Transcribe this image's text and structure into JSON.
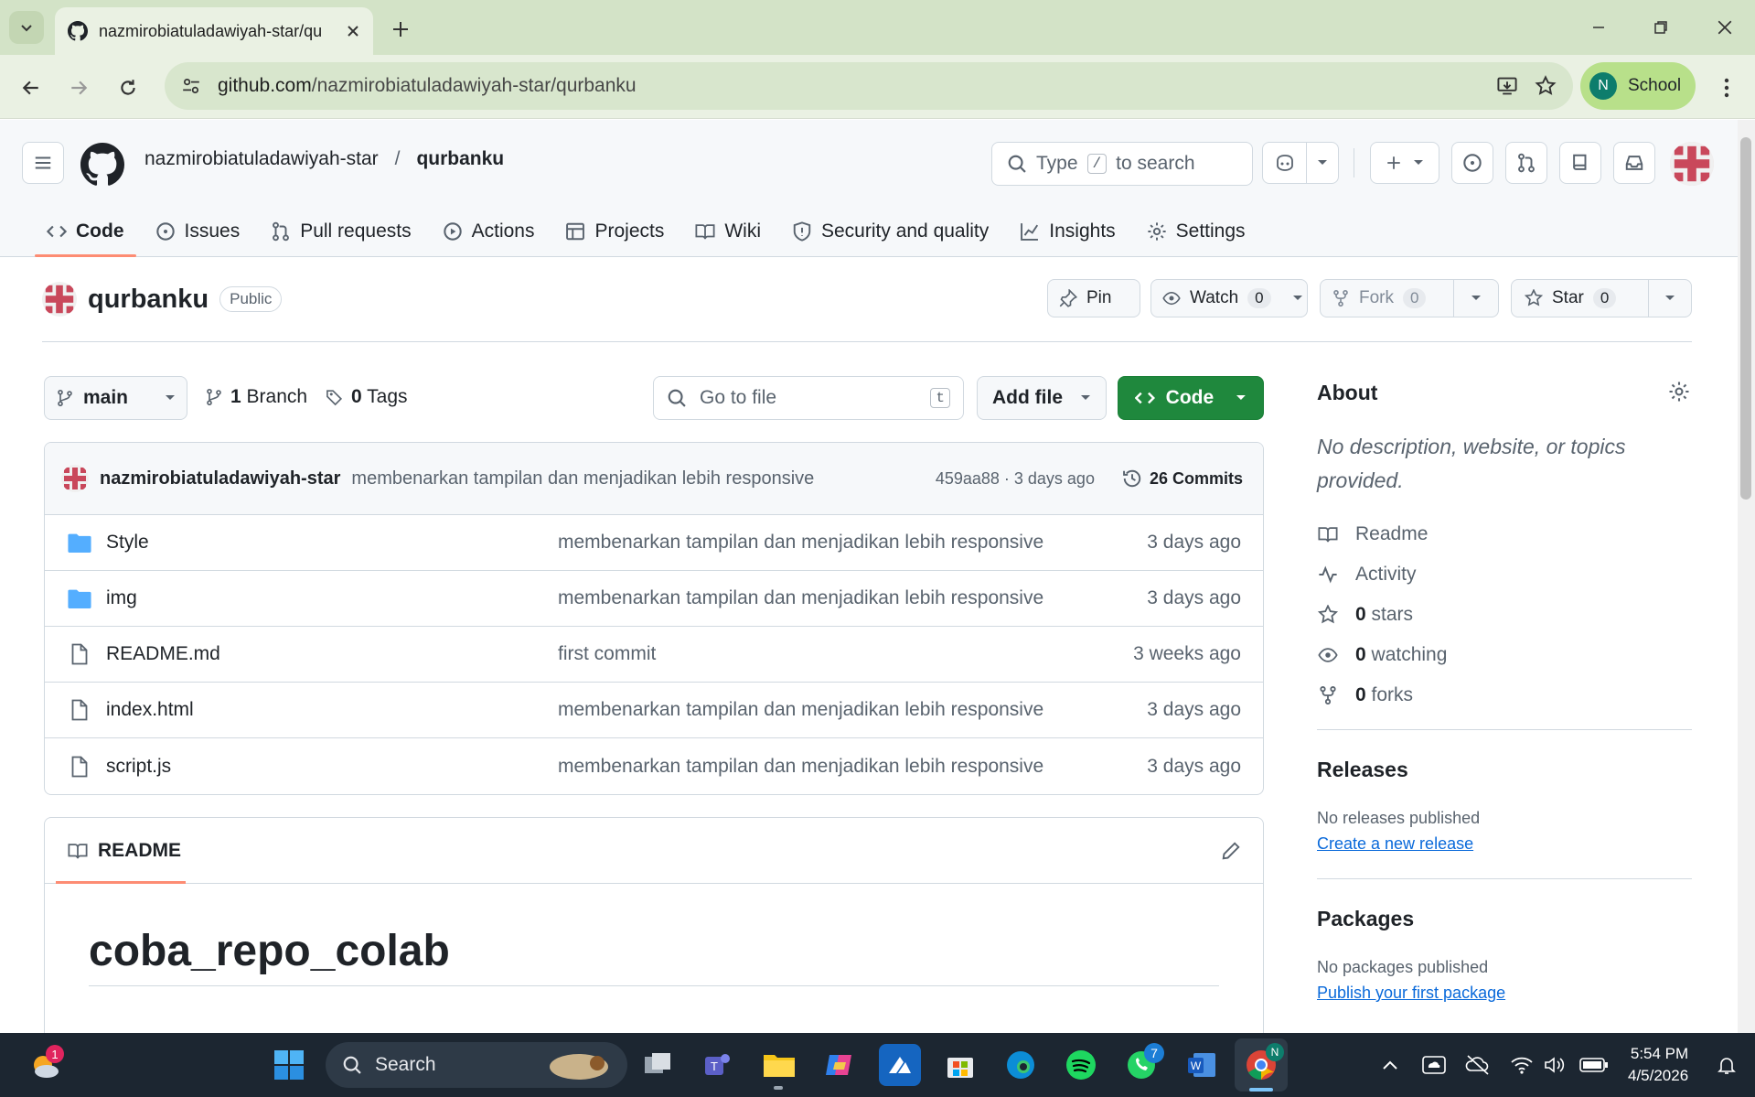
{
  "browser": {
    "tab_title": "nazmirobiatuladawiyah-star/qu",
    "url_host": "github.com",
    "url_path": "/nazmirobiatuladawiyah-star/qurbanku",
    "profile_initial": "N",
    "profile_label": "School"
  },
  "header": {
    "owner": "nazmirobiatuladawiyah-star",
    "separator": "/",
    "repo": "qurbanku",
    "search_prefix": "Type",
    "search_key": "/",
    "search_suffix": "to search"
  },
  "repo_nav": [
    {
      "label": "Code",
      "icon": "code-icon",
      "active": true
    },
    {
      "label": "Issues",
      "icon": "issue-icon"
    },
    {
      "label": "Pull requests",
      "icon": "pull-request-icon"
    },
    {
      "label": "Actions",
      "icon": "play-icon"
    },
    {
      "label": "Projects",
      "icon": "table-icon"
    },
    {
      "label": "Wiki",
      "icon": "book-icon"
    },
    {
      "label": "Security and quality",
      "icon": "shield-icon"
    },
    {
      "label": "Insights",
      "icon": "graph-icon"
    },
    {
      "label": "Settings",
      "icon": "gear-icon"
    }
  ],
  "repo_title": {
    "name": "qurbanku",
    "visibility": "Public",
    "pin_label": "Pin",
    "watch_label": "Watch",
    "watch_count": "0",
    "fork_label": "Fork",
    "fork_count": "0",
    "star_label": "Star",
    "star_count": "0"
  },
  "file_browser": {
    "branch": "main",
    "branch_count": "1",
    "branch_label": "Branch",
    "tag_count": "0",
    "tag_label": "Tags",
    "goto_placeholder": "Go to file",
    "goto_key": "t",
    "add_file_label": "Add file",
    "code_label": "Code",
    "latest_commit": {
      "author": "nazmirobiatuladawiyah-star",
      "message": "membenarkan tampilan dan menjadikan lebih responsive",
      "sha_time": "459aa88 · 3 days ago",
      "commits_label": "26 Commits"
    },
    "files": [
      {
        "name": "Style",
        "type": "folder",
        "message": "membenarkan tampilan dan menjadikan lebih responsive",
        "time": "3 days ago"
      },
      {
        "name": "img",
        "type": "folder",
        "message": "membenarkan tampilan dan menjadikan lebih responsive",
        "time": "3 days ago"
      },
      {
        "name": "README.md",
        "type": "file",
        "message": "first commit",
        "time": "3 weeks ago"
      },
      {
        "name": "index.html",
        "type": "file",
        "message": "membenarkan tampilan dan menjadikan lebih responsive",
        "time": "3 days ago"
      },
      {
        "name": "script.js",
        "type": "file",
        "message": "membenarkan tampilan dan menjadikan lebih responsive",
        "time": "3 days ago"
      }
    ]
  },
  "readme": {
    "tab_label": "README",
    "heading": "coba_repo_colab"
  },
  "sidebar": {
    "about_title": "About",
    "description": "No description, website, or topics provided.",
    "items": [
      {
        "icon": "book-icon",
        "count": "",
        "label": "Readme"
      },
      {
        "icon": "pulse-icon",
        "count": "",
        "label": "Activity"
      },
      {
        "icon": "star-icon",
        "count": "0",
        "label": "stars"
      },
      {
        "icon": "eye-icon",
        "count": "0",
        "label": "watching"
      },
      {
        "icon": "fork-icon",
        "count": "0",
        "label": "forks"
      }
    ],
    "releases_title": "Releases",
    "releases_text": "No releases published",
    "releases_link": "Create a new release",
    "packages_title": "Packages",
    "packages_text": "No packages published",
    "packages_link": "Publish your first package"
  },
  "taskbar": {
    "search_label": "Search",
    "weather_badge": "1",
    "whatsapp_badge": "7",
    "chrome_badge": "N",
    "time": "5:54 PM",
    "date": "4/5/2026"
  },
  "colors": {
    "accent_green": "#1f883d",
    "tab_underline": "#fd8c73",
    "link_blue": "#0969da",
    "folder_blue": "#54aeff"
  }
}
